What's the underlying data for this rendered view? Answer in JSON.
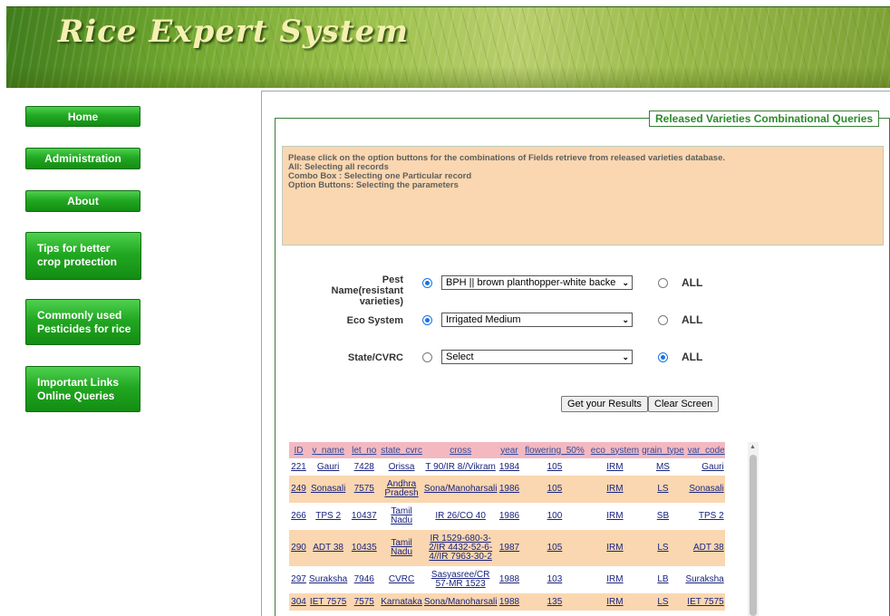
{
  "banner": {
    "title": "Rice Expert System"
  },
  "sidebar": {
    "items": [
      {
        "label": "Home"
      },
      {
        "label": "Administration"
      },
      {
        "label": "About"
      },
      {
        "label": "Tips for better crop protection"
      },
      {
        "label": "Commonly used Pesticides for rice"
      },
      {
        "label": "Important Links Online Queries"
      }
    ]
  },
  "section": {
    "title": "Released Varieties Combinational Queries",
    "info_lines": [
      "Please click on the option buttons for the combinations of Fields retrieve from released varieties database.",
      "All: Selecting all records",
      "Combo Box : Selecting one Particular record",
      "Option Buttons: Selecting the parameters"
    ]
  },
  "form": {
    "pest": {
      "label": "Pest Name(resistant varieties)",
      "value": "BPH || brown planthopper-white backed plant",
      "all_label": "ALL"
    },
    "eco": {
      "label": "Eco System",
      "value": "Irrigated Medium",
      "all_label": "ALL"
    },
    "state": {
      "label": "State/CVRC",
      "value": "Select",
      "all_label": "ALL"
    },
    "get_results_label": "Get your Results",
    "clear_label": "Clear Screen"
  },
  "table": {
    "headers": [
      "ID",
      "v_name",
      "let_no",
      "state_cvrc",
      "cross",
      "year",
      "flowering_50%",
      "eco_system",
      "grain_type",
      "var_code"
    ],
    "rows": [
      [
        "221",
        "Gauri",
        "7428",
        "Orissa",
        "T 90/IR 8//Vikram",
        "1984",
        "105",
        "IRM",
        "MS",
        "Gauri"
      ],
      [
        "249",
        "Sonasali",
        "7575",
        "Andhra Pradesh",
        "Sona/Manoharsali",
        "1986",
        "105",
        "IRM",
        "LS",
        "Sonasali"
      ],
      [
        "266",
        "TPS 2",
        "10437",
        "Tamil Nadu",
        "IR 26/CO 40",
        "1986",
        "100",
        "IRM",
        "SB",
        "TPS 2"
      ],
      [
        "290",
        "ADT 38",
        "10435",
        "Tamil Nadu",
        "IR 1529-680-3-2/IR 4432-52-6-4//IR 7963-30-2",
        "1987",
        "105",
        "IRM",
        "LS",
        "ADT 38"
      ],
      [
        "297",
        "Suraksha",
        "7946",
        "CVRC",
        "Sasyasree/CR 57-MR 1523",
        "1988",
        "103",
        "IRM",
        "LB",
        "Suraksha"
      ],
      [
        "304",
        "IET 7575",
        "7575",
        "Karnataka",
        "Sona/Manoharsali",
        "1988",
        "135",
        "IRM",
        "LS",
        "IET 7575"
      ]
    ]
  },
  "colors": {
    "nav_green": "#22a822",
    "title_green": "#2a8b2a",
    "info_bg": "#fad7b0",
    "table_header_bg": "#f4b8c0",
    "radio_blue": "#1a73e8"
  }
}
